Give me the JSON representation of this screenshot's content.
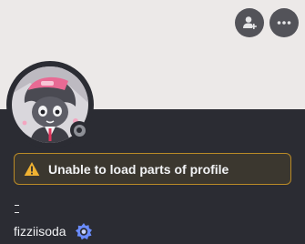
{
  "profile": {
    "username": "fizziisoda",
    "warning_text": "Unable to load parts of profile",
    "status": "offline"
  },
  "icons": {
    "add_friend": "add-friend-icon",
    "more": "more-icon",
    "warning": "warning-icon",
    "badge": "nitro-badge-icon"
  },
  "colors": {
    "banner": "#ece9e8",
    "panel": "#2b2c33",
    "warning_border": "#b98a27",
    "warning_icon": "#f0b232",
    "badge": "#6a8cff"
  }
}
